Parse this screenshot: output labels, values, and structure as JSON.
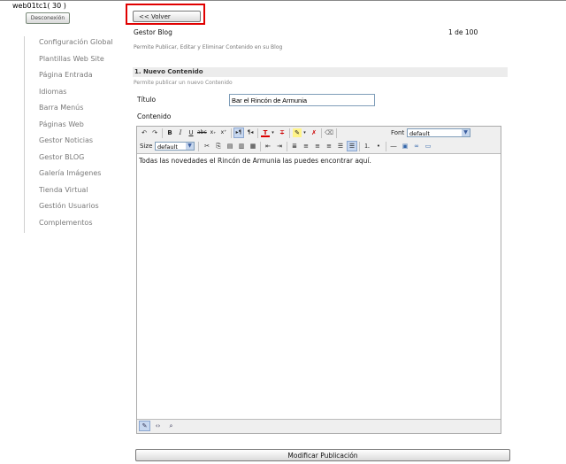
{
  "header": {
    "user": "web01tc1( 30 )",
    "logout_label": "Desconexión"
  },
  "sidebar": {
    "items": [
      {
        "label": "Configuración Global"
      },
      {
        "label": "Plantillas Web Site"
      },
      {
        "label": "Página Entrada"
      },
      {
        "label": "Idiomas"
      },
      {
        "label": "Barra Menús"
      },
      {
        "label": "Páginas Web"
      },
      {
        "label": "Gestor Noticias"
      },
      {
        "label": "Gestor BLOG"
      },
      {
        "label": "Galería Imágenes"
      },
      {
        "label": "Tienda Virtual"
      },
      {
        "label": "Gestión Usuarios"
      },
      {
        "label": "Complementos"
      }
    ]
  },
  "main": {
    "back_label": "<< Volver",
    "title": "Gestor Blog",
    "page_indicator": "1  de 100",
    "description": "Permite Publicar, Editar y Eliminar Contenido en su Blog",
    "section": {
      "title": "1. Nuevo Contenido",
      "description": "Permite publicar un nuevo Contenido"
    },
    "titulo_label": "Título",
    "titulo_value": "Bar el Rincón de Armunia",
    "contenido_label": "Contenido",
    "editor": {
      "font_label": "Font",
      "font_value": "default",
      "size_label": "Size",
      "size_value": "default",
      "content": "Todas las novedades el Rincón de Armunia las puedes encontrar aquí."
    },
    "submit_label": "Modificar Publicación"
  },
  "colors": {
    "highlight": "#e00000",
    "link_gray": "#7a7a7a",
    "section_bg": "#ececec"
  }
}
